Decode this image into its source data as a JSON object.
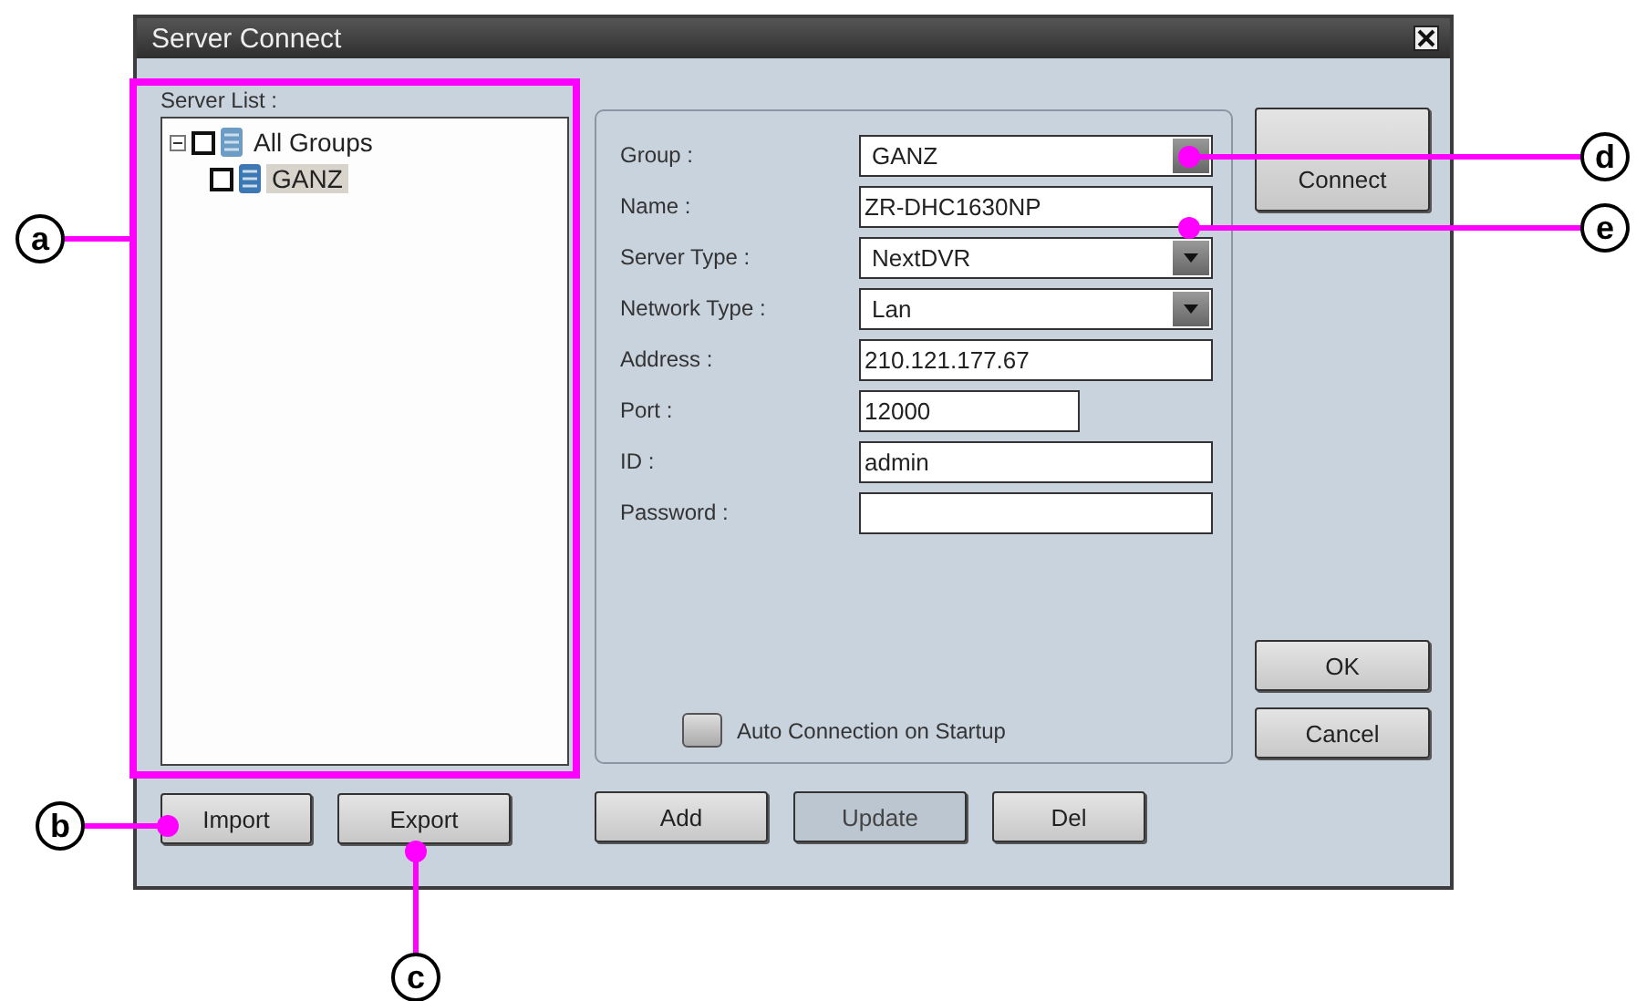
{
  "window": {
    "title": "Server Connect"
  },
  "server_list": {
    "label": "Server List :",
    "tree": [
      {
        "label": "All Groups",
        "checked": false,
        "expanded": true,
        "selected": false,
        "children": [
          {
            "label": "GANZ",
            "checked": false,
            "selected": true
          }
        ]
      }
    ]
  },
  "fields": [
    {
      "kind": "dropdown",
      "label": "Group :",
      "value": "GANZ"
    },
    {
      "kind": "text",
      "label": "Name :",
      "value": "ZR-DHC1630NP"
    },
    {
      "kind": "dropdown",
      "label": "Server Type :",
      "value": "NextDVR"
    },
    {
      "kind": "dropdown",
      "label": "Network Type :",
      "value": "Lan"
    },
    {
      "kind": "text",
      "label": "Address :",
      "value": "210.121.177.67"
    },
    {
      "kind": "short",
      "label": "Port :",
      "value": "12000"
    },
    {
      "kind": "text",
      "label": "ID :",
      "value": "admin"
    },
    {
      "kind": "text",
      "label": "Password :"
    }
  ],
  "auto_connection": {
    "label": "Auto Connection on Startup",
    "checked": false
  },
  "side_buttons": [
    {
      "label": "Connect",
      "disabled": false
    },
    {
      "label": "OK",
      "disabled": false
    },
    {
      "label": "Cancel",
      "disabled": false
    }
  ],
  "list_buttons": [
    {
      "label": "Import",
      "disabled": false
    },
    {
      "label": "Export",
      "disabled": false
    }
  ],
  "edit_buttons": [
    {
      "label": "Add",
      "disabled": false
    },
    {
      "label": "Update",
      "disabled": true
    },
    {
      "label": "Del",
      "disabled": false
    }
  ],
  "callouts": [
    {
      "label": "a"
    },
    {
      "label": "b"
    },
    {
      "label": "c"
    },
    {
      "label": "d"
    },
    {
      "label": "e"
    }
  ]
}
